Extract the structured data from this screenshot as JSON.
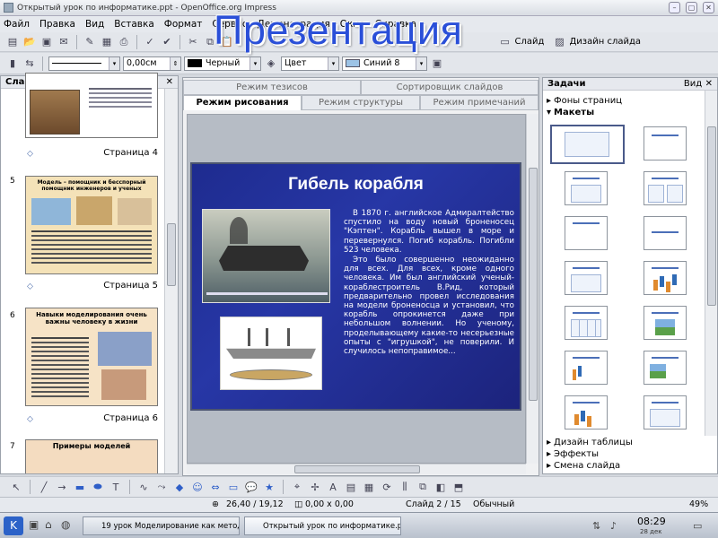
{
  "window": {
    "title": "Открытый урок по информатике.ppt - OpenOffice.org Impress"
  },
  "overlay_title": "Презентация",
  "menu": [
    "Файл",
    "Правка",
    "Вид",
    "Вставка",
    "Формат",
    "Сервис",
    "Демонстрация",
    "Окно",
    "Справка"
  ],
  "toolbar": {
    "slide_label": "Слайд",
    "slide_design_label": "Дизайн слайда"
  },
  "format_bar": {
    "line_width": "0,00см",
    "line_color": "Черный",
    "area_style": "Цвет",
    "area_color": "Синий 8"
  },
  "slides_panel": {
    "title": "Слайды",
    "thumbs": [
      {
        "num": "",
        "label": "Страница 4",
        "heading": ""
      },
      {
        "num": "5",
        "label": "Страница 5",
        "heading": "Модель – помощник и бесспорный помощник инженеров и ученых"
      },
      {
        "num": "6",
        "label": "Страница 6",
        "heading": "Навыки моделирования очень важны человеку в жизни"
      },
      {
        "num": "7",
        "label": "",
        "heading": "Примеры моделей"
      }
    ]
  },
  "view_tabs": {
    "row1": [
      "Режим тезисов",
      "Сортировщик слайдов"
    ],
    "row2": [
      "Режим рисования",
      "Режим структуры",
      "Режим примечаний"
    ],
    "active": "Режим рисования"
  },
  "slide": {
    "title": "Гибель корабля",
    "para1": "В 1870 г. английское Адмиралтейство спустило на воду новый броненосец \"Кэптен\". Корабль вышел в море и перевернулся. Погиб корабль. Погибли 523 человека.",
    "para2": "Это было совершенно неожиданно для всех. Для всех, кроме одного человека. Им был английский ученый-кораблестроитель В.Рид, который предварительно провел исследования на модели броненосца и установил, что корабль опрокинется даже при небольшом волнении. Но ученому, проделывающему какие-то несерьезные опыты с \"игрушкой\", не поверили. И случилось непоправимое..."
  },
  "tasks": {
    "title": "Задачи",
    "view_menu": "Вид",
    "sections_top": [
      "Фоны страниц",
      "Макеты"
    ],
    "sections_bottom": [
      "Дизайн таблицы",
      "Эффекты",
      "Смена слайда"
    ]
  },
  "status": {
    "position": "26,40 / 19,12",
    "size": "0,00 x 0,00",
    "slide": "Слайд 2 / 15",
    "layout": "Обычный",
    "zoom": "49%"
  },
  "taskbar": {
    "tasks": [
      "19 урок Моделирование как метод позна...",
      "Открытый урок по информатике.ppt - O..."
    ],
    "time": "08:29",
    "date": "28 дек"
  },
  "colors": {
    "accent": "#2a4fd8",
    "slide_bg": "#1e2b8f"
  }
}
